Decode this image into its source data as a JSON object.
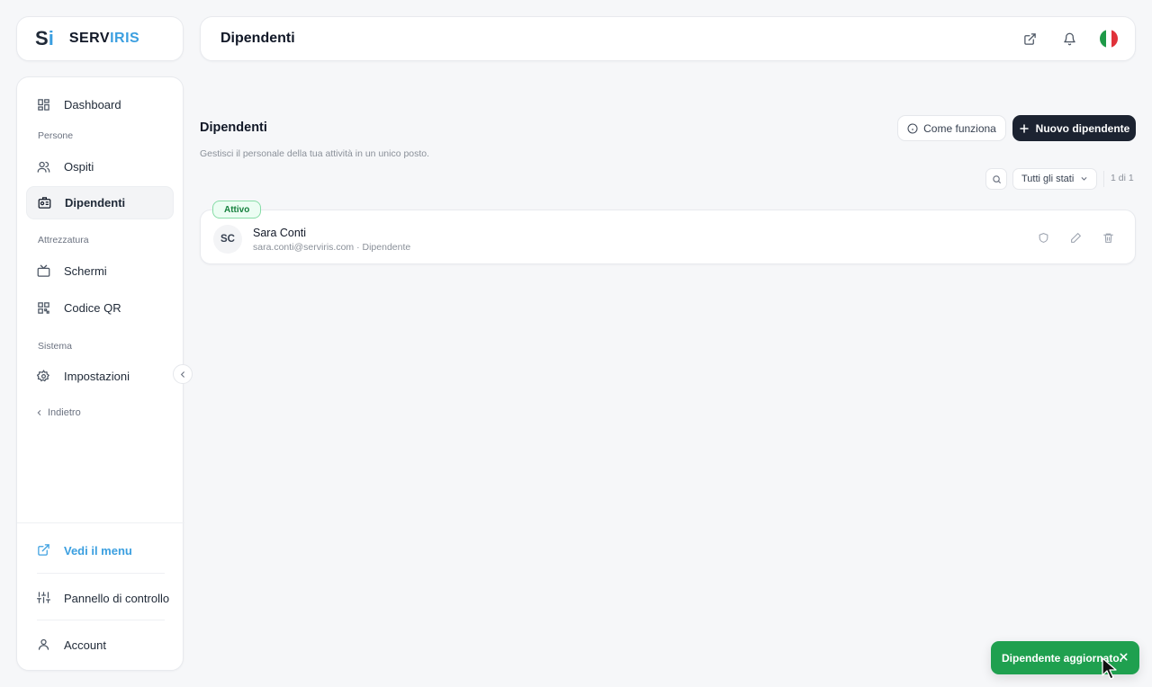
{
  "brand": {
    "mark_s": "S",
    "mark_i": "i",
    "word_a": "SERV",
    "word_b": "IRIS",
    "accent": "#3b9fe0"
  },
  "header": {
    "title": "Dipendenti",
    "icons": [
      "external-link-icon",
      "bell-icon",
      "italy-flag-icon"
    ]
  },
  "sidebar": {
    "items": [
      {
        "label": "Dashboard",
        "icon": "dashboard-icon"
      },
      {
        "section": "Persone"
      },
      {
        "label": "Ospiti",
        "icon": "users-icon"
      },
      {
        "label": "Dipendenti",
        "icon": "id-card-icon",
        "active": true
      },
      {
        "section": "Attrezzatura"
      },
      {
        "label": "Schermi",
        "icon": "tv-icon"
      },
      {
        "label": "Codice QR",
        "icon": "qr-icon"
      },
      {
        "section": "Sistema"
      },
      {
        "label": "Impostazioni",
        "icon": "gear-icon"
      }
    ],
    "back": "Indietro",
    "bottom": {
      "menu": "Vedi il menu",
      "control_panel": "Pannello di controllo",
      "account": "Account"
    }
  },
  "main": {
    "title": "Dipendenti",
    "subtitle": "Gestisci il personale della tua attività in un unico posto.",
    "how_it_works": "Come funziona",
    "new_employee": "Nuovo dipendente",
    "filter_value": "Tutti gli stati",
    "pager": "1 di 1",
    "employees": [
      {
        "status": "Attivo",
        "initials": "SC",
        "name": "Sara Conti",
        "meta": "sara.conti@serviris.com · Dipendente"
      }
    ]
  },
  "toast": {
    "message": "Dipendente aggiornato.",
    "color": "#1fa04f"
  }
}
